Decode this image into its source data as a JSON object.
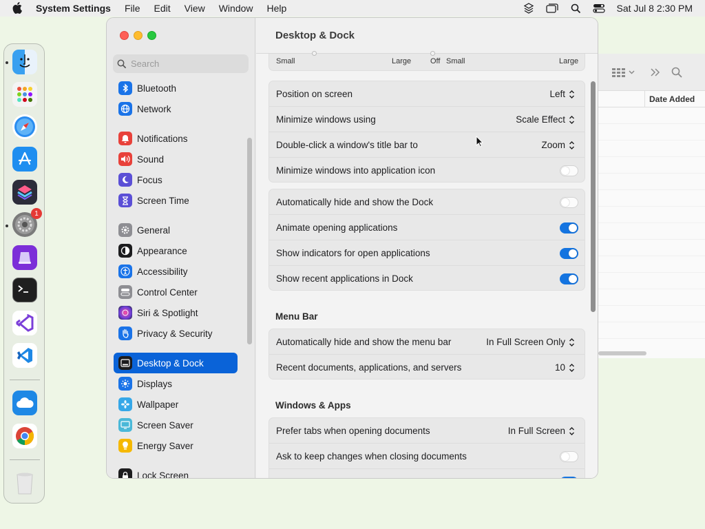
{
  "menubar": {
    "app_name": "System Settings",
    "menus": [
      "File",
      "Edit",
      "View",
      "Window",
      "Help"
    ],
    "clock": "Sat Jul 8  2:30 PM",
    "status_icons": [
      "stack-icon",
      "windows-icon",
      "search-icon",
      "control-center-icon"
    ]
  },
  "dock": {
    "apps": [
      "Finder",
      "Launchpad",
      "Safari",
      "App Store",
      "Shortcuts",
      "System Settings",
      "Apple Configurator",
      "Terminal",
      "Visual Studio",
      "Visual Studio Code",
      "iCloud Drive",
      "Google Chrome",
      "Trash"
    ],
    "settings_badge": "1"
  },
  "background_window": {
    "column_header": "Date Added"
  },
  "window": {
    "title": "Desktop & Dock",
    "search_placeholder": "Search"
  },
  "sidebar": {
    "items": [
      {
        "label": "Bluetooth",
        "icon": "bluetooth-icon",
        "color": "#1a73e8"
      },
      {
        "label": "Network",
        "icon": "globe-icon",
        "color": "#1a73e8"
      },
      {
        "label": "Notifications",
        "icon": "bell-icon",
        "color": "#e8413a"
      },
      {
        "label": "Sound",
        "icon": "speaker-icon",
        "color": "#e8413a"
      },
      {
        "label": "Focus",
        "icon": "moon-icon",
        "color": "#5b4fd6"
      },
      {
        "label": "Screen Time",
        "icon": "hourglass-icon",
        "color": "#5b4fd6"
      },
      {
        "label": "General",
        "icon": "gear-icon",
        "color": "#8e8e93"
      },
      {
        "label": "Appearance",
        "icon": "circle-half-icon",
        "color": "#1c1c1e"
      },
      {
        "label": "Accessibility",
        "icon": "accessibility-icon",
        "color": "#1a73e8"
      },
      {
        "label": "Control Center",
        "icon": "switches-icon",
        "color": "#8e8e93"
      },
      {
        "label": "Siri & Spotlight",
        "icon": "siri-icon",
        "color": "#b03cc8"
      },
      {
        "label": "Privacy & Security",
        "icon": "hand-icon",
        "color": "#1a73e8"
      },
      {
        "label": "Desktop & Dock",
        "icon": "dock-icon",
        "color": "#1c1c1e"
      },
      {
        "label": "Displays",
        "icon": "sun-icon",
        "color": "#1a73e8"
      },
      {
        "label": "Wallpaper",
        "icon": "flower-icon",
        "color": "#35a7e8"
      },
      {
        "label": "Screen Saver",
        "icon": "screensaver-icon",
        "color": "#4ab8d8"
      },
      {
        "label": "Energy Saver",
        "icon": "bulb-icon",
        "color": "#f5b800"
      },
      {
        "label": "Lock Screen",
        "icon": "lock-icon",
        "color": "#1c1c1e"
      }
    ],
    "selected": "Desktop & Dock"
  },
  "sliders": {
    "left_min": "Small",
    "left_max": "Large",
    "right_off": "Off",
    "right_min": "Small",
    "right_max": "Large"
  },
  "dock_settings": [
    {
      "label": "Position on screen",
      "value": "Left"
    },
    {
      "label": "Minimize windows using",
      "value": "Scale Effect"
    },
    {
      "label": "Double-click a window's title bar to",
      "value": "Zoom"
    },
    {
      "label": "Minimize windows into application icon",
      "toggle": false
    }
  ],
  "dock_behavior": [
    {
      "label": "Automatically hide and show the Dock",
      "toggle": false
    },
    {
      "label": "Animate opening applications",
      "toggle": true
    },
    {
      "label": "Show indicators for open applications",
      "toggle": true
    },
    {
      "label": "Show recent applications in Dock",
      "toggle": true
    }
  ],
  "menu_bar": {
    "heading": "Menu Bar",
    "rows": [
      {
        "label": "Automatically hide and show the menu bar",
        "value": "In Full Screen Only"
      },
      {
        "label": "Recent documents, applications, and servers",
        "value": "10"
      }
    ]
  },
  "windows_apps": {
    "heading": "Windows & Apps",
    "rows": [
      {
        "label": "Prefer tabs when opening documents",
        "value": "In Full Screen"
      },
      {
        "label": "Ask to keep changes when closing documents",
        "toggle": false
      }
    ]
  },
  "accent_color": "#0a63d8",
  "toggle_on_color": "#1474e0"
}
